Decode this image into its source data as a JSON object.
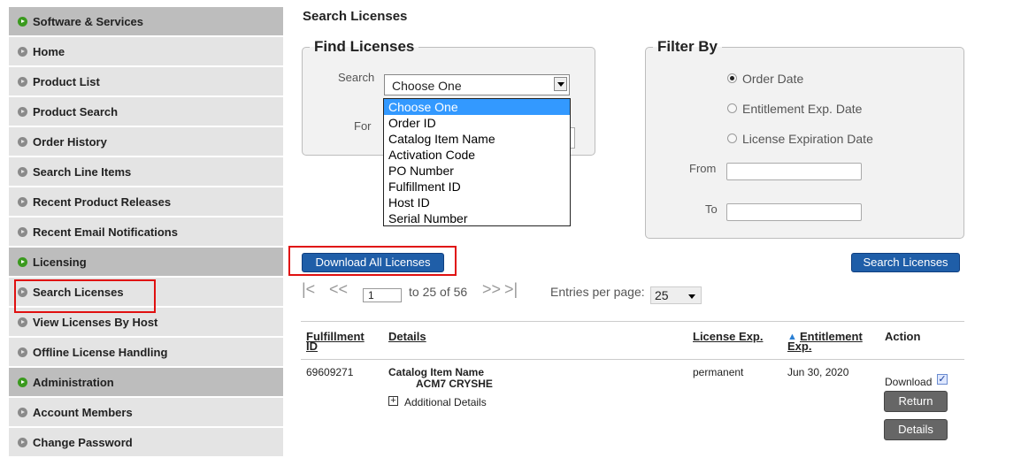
{
  "sidebar": {
    "items": [
      {
        "label": "Software & Services",
        "type": "section",
        "icon": "play-circle-green-icon"
      },
      {
        "label": "Home",
        "type": "item"
      },
      {
        "label": "Product List",
        "type": "item"
      },
      {
        "label": "Product Search",
        "type": "item"
      },
      {
        "label": "Order History",
        "type": "item"
      },
      {
        "label": "Search Line Items",
        "type": "item"
      },
      {
        "label": "Recent Product Releases",
        "type": "item"
      },
      {
        "label": "Recent Email Notifications",
        "type": "item"
      },
      {
        "label": "Licensing",
        "type": "section"
      },
      {
        "label": "Search Licenses",
        "type": "item",
        "active": true
      },
      {
        "label": "View Licenses By Host",
        "type": "item"
      },
      {
        "label": "Offline License Handling",
        "type": "item"
      },
      {
        "label": "Administration",
        "type": "section"
      },
      {
        "label": "Account Members",
        "type": "item"
      },
      {
        "label": "Change Password",
        "type": "item"
      }
    ]
  },
  "page": {
    "title": "Search Licenses"
  },
  "find": {
    "legend": "Find Licenses",
    "search_label": "Search",
    "for_label": "For",
    "selected": "Choose One",
    "options": [
      "Choose One",
      "Order ID",
      "Catalog Item Name",
      "Activation Code",
      "PO Number",
      "Fulfillment ID",
      "Host ID",
      "Serial Number"
    ]
  },
  "filter": {
    "legend": "Filter By",
    "radios": [
      "Order Date",
      "Entitlement Exp. Date",
      "License Expiration Date"
    ],
    "selected_radio": "Order Date",
    "from_label": "From",
    "to_label": "To"
  },
  "buttons": {
    "download_all": "Download All Licenses",
    "search": "Search Licenses"
  },
  "pager": {
    "page_value": "1",
    "range_text": "to 25 of 56",
    "entries_label": "Entries per page:",
    "entries_value": "25"
  },
  "table": {
    "headers": {
      "fulfillment_1": "Fulfillment",
      "fulfillment_2": "ID",
      "details": "Details",
      "license_exp": "License Exp.",
      "entitlement_1": "Entitlement",
      "entitlement_2": "Exp.",
      "action": "Action"
    },
    "rows": [
      {
        "fulfillment_id": "69609271",
        "details_label": "Catalog Item Name",
        "details_value": "ACM7 CRYSHE",
        "additional": "Additional Details",
        "license_exp": "permanent",
        "entitlement_exp": "Jun 30, 2020",
        "download_label": "Download",
        "return_label": "Return",
        "details_button": "Details"
      }
    ]
  },
  "colors": {
    "highlight": "#e01010",
    "accent": "#1f5ea8",
    "section_icon": "#3a9a1e"
  }
}
